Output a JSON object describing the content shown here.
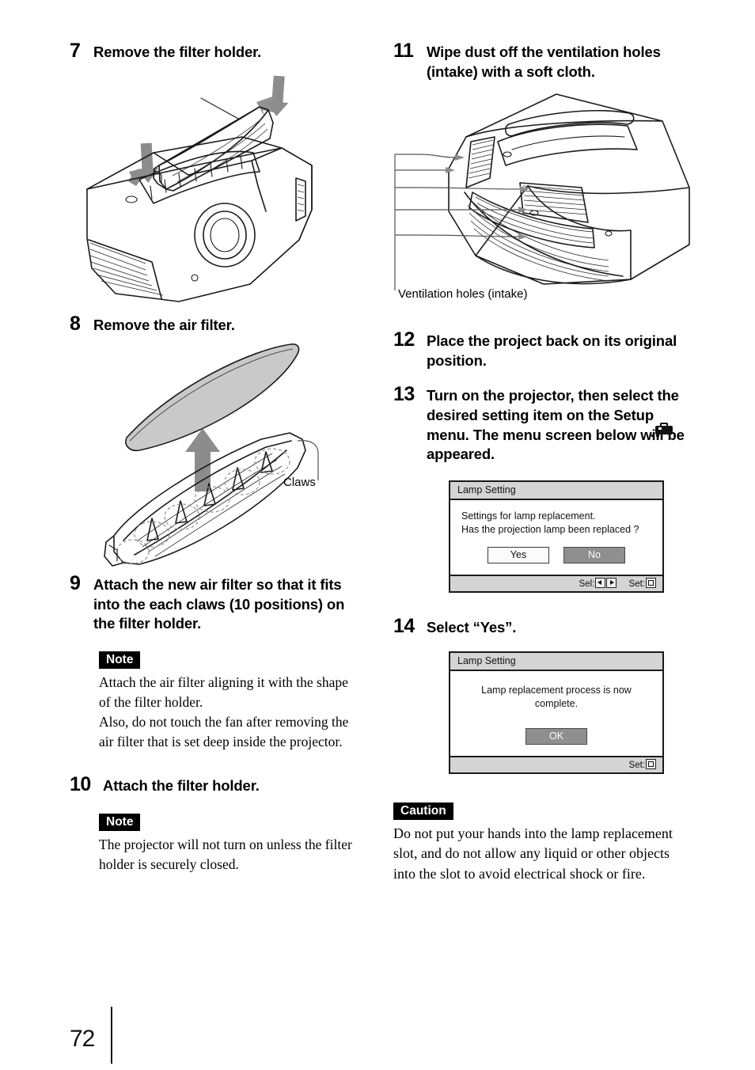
{
  "page": {
    "number": "72"
  },
  "left_column": {
    "steps": [
      {
        "number": "7",
        "text": "Remove the filter holder."
      },
      {
        "number": "8",
        "text": "Remove the air filter."
      },
      {
        "number": "9",
        "text": "Attach the new air filter so that it fits into the each claws (10 positions) on the filter holder."
      },
      {
        "number": "10",
        "text": "Attach the filter holder."
      }
    ],
    "figure_labels": {
      "claws": "Claws"
    },
    "notes": [
      {
        "tag": "Note",
        "body": "Attach the air filter aligning it with the shape of the filter holder.\nAlso, do not touch the fan after removing the air filter that is set deep inside the projector."
      },
      {
        "tag": "Note",
        "body": "The projector will not turn on unless the filter holder is securely closed."
      }
    ]
  },
  "right_column": {
    "steps": [
      {
        "number": "11",
        "text": "Wipe dust off the ventilation holes (intake) with a soft cloth."
      },
      {
        "number": "12",
        "text": "Place the project back on its original position."
      },
      {
        "number": "13",
        "text_before_icon": "Turn on the projector, then select the desired setting item on the Setup",
        "icon": "toolbox-icon",
        "text_after_icon": "menu. The menu screen below will be appeared."
      },
      {
        "number": "14",
        "text": "Select “Yes”."
      }
    ],
    "figure_labels": {
      "ventilation_holes": "Ventilation holes (intake)"
    },
    "osd_dialogs": [
      {
        "title": "Lamp Setting",
        "lines": [
          "Settings for lamp replacement.",
          "Has the projection lamp been replaced ?"
        ],
        "buttons": [
          {
            "label": "Yes",
            "selected": false
          },
          {
            "label": "No",
            "selected": true
          }
        ],
        "footer": {
          "sel_label": "Sel:",
          "set_label": "Set:"
        }
      },
      {
        "title": "Lamp Setting",
        "lines": [
          "Lamp replacement process is now complete."
        ],
        "buttons": [
          {
            "label": "OK",
            "selected": true
          }
        ],
        "footer": {
          "sel_label": "",
          "set_label": "Set:"
        }
      }
    ],
    "caution": {
      "tag": "Caution",
      "body": "Do not put your hands into the lamp replacement slot, and do not allow any liquid or other objects into the slot to avoid electrical shock or fire."
    }
  },
  "colors": {
    "ink": "#1a1a1a",
    "arrow_gray": "#8c8c8c",
    "filter_gray": "#c9c9c9",
    "osd_chrome": "#d4d4d4",
    "osd_selected": "#8f8f8f"
  }
}
